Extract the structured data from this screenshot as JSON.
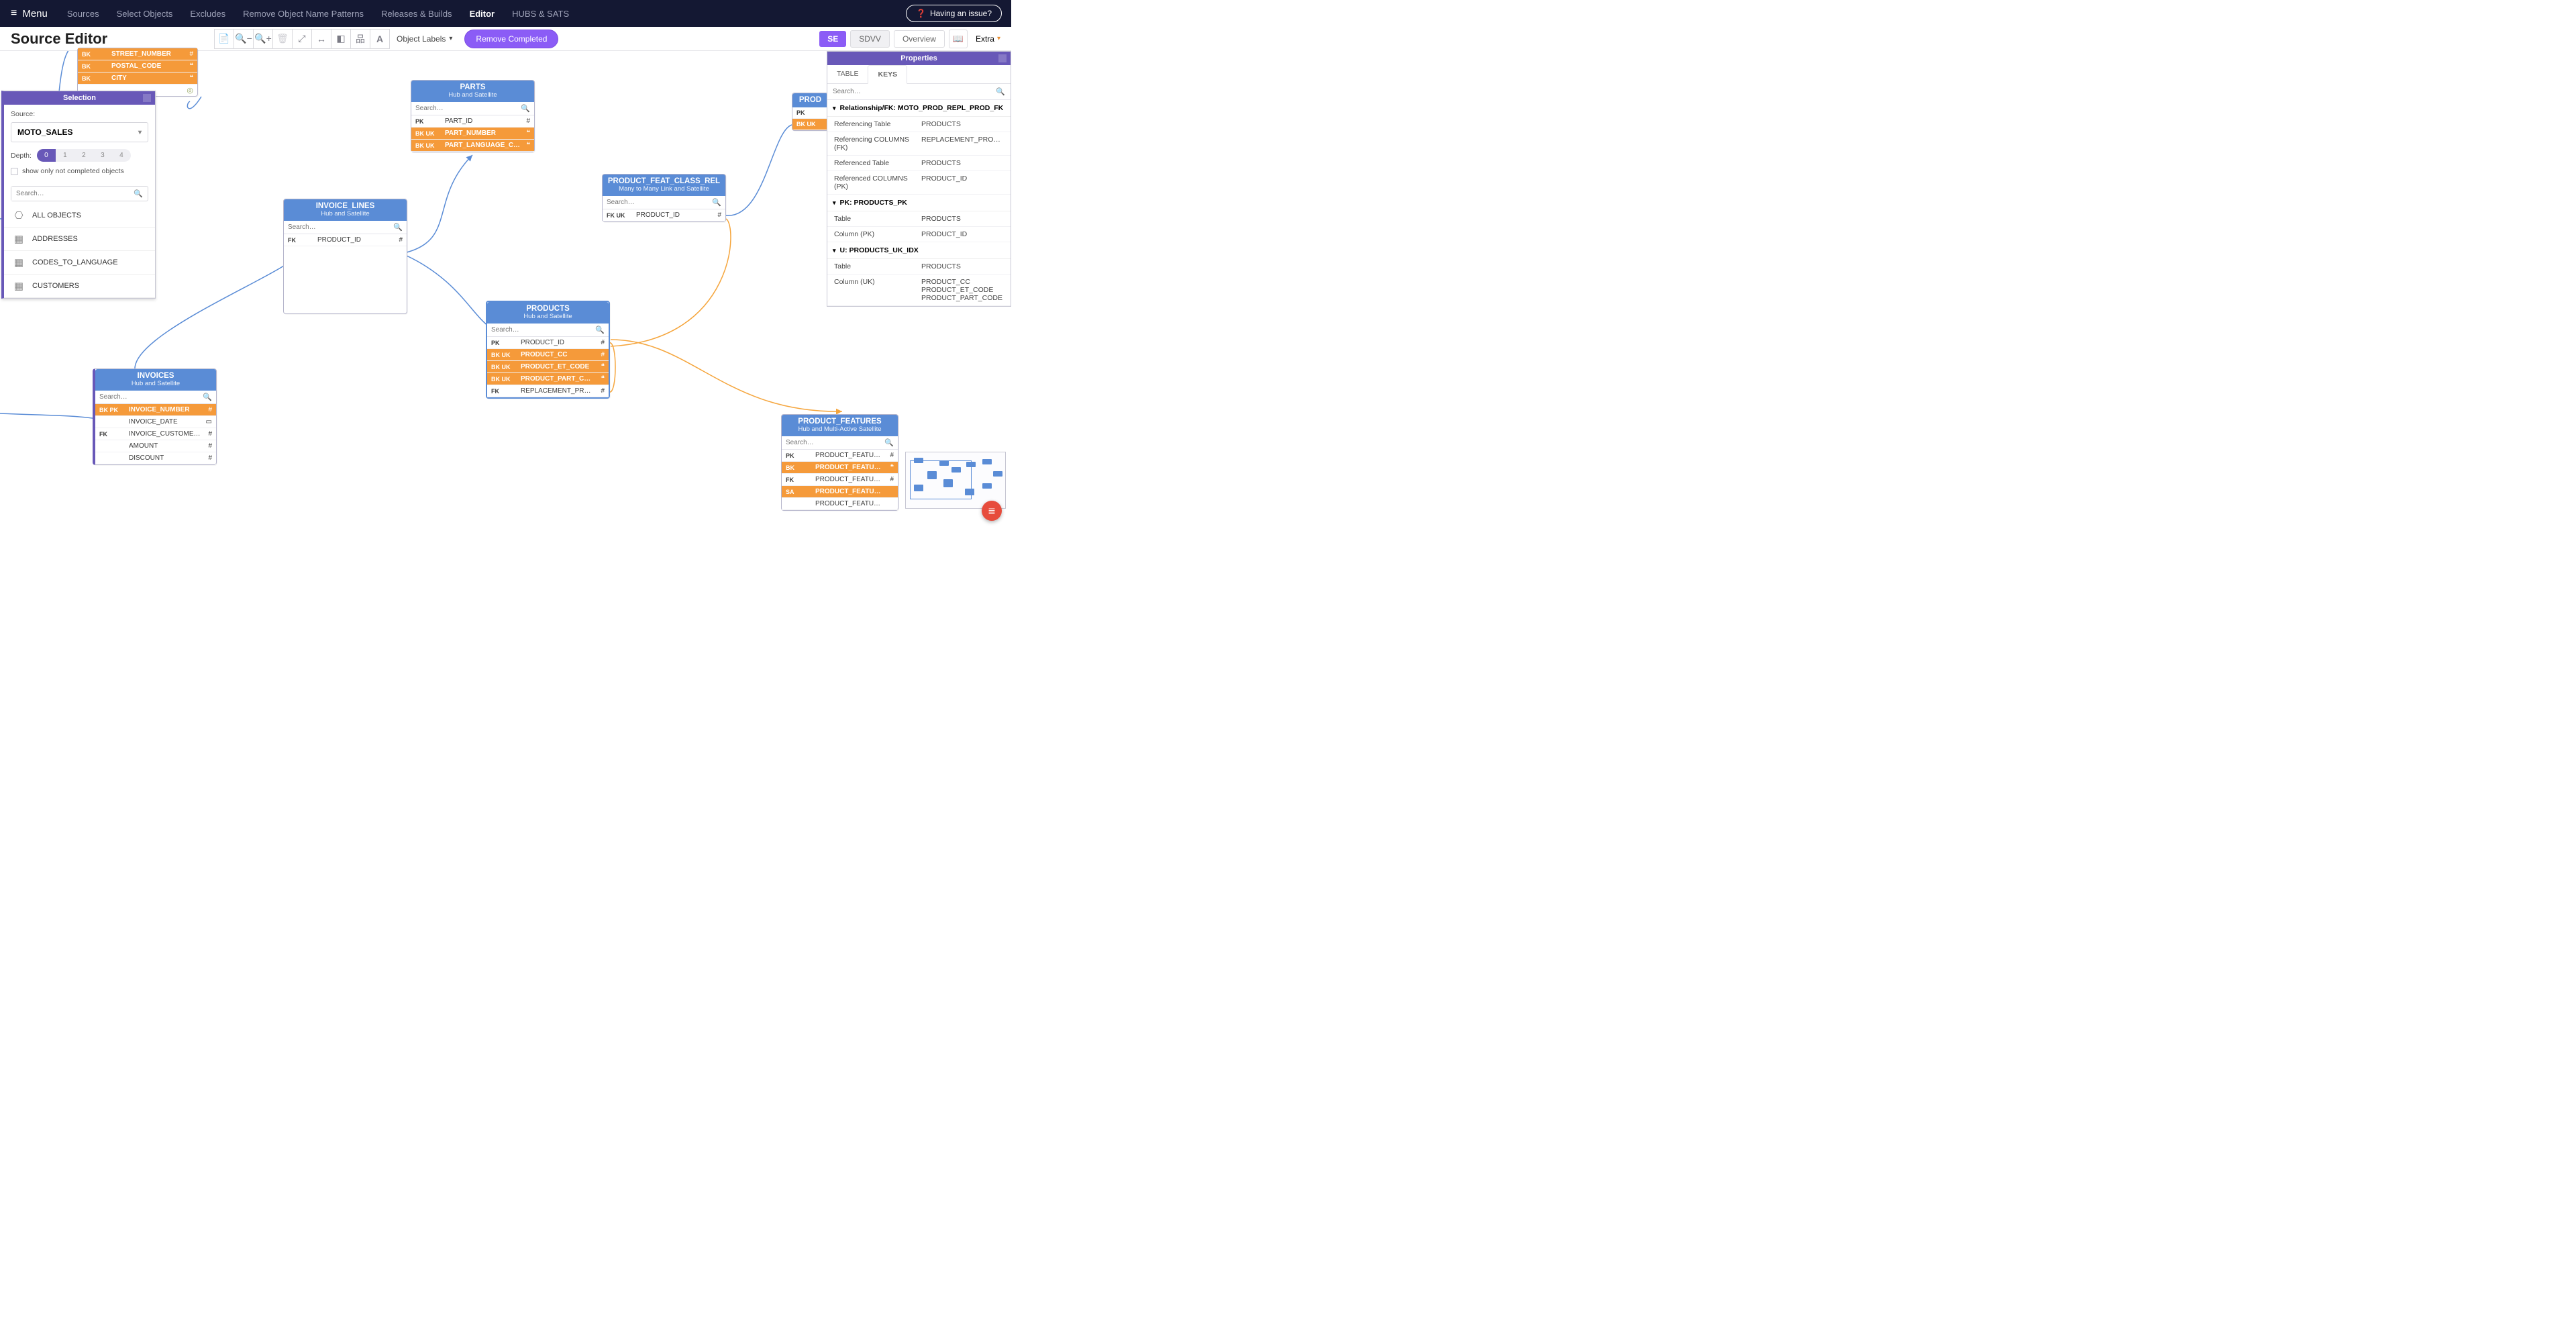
{
  "nav": {
    "menu": "Menu",
    "items": [
      "Sources",
      "Select Objects",
      "Excludes",
      "Remove Object Name Patterns",
      "Releases & Builds",
      "Editor",
      "HUBS & SATS"
    ],
    "active_index": 5,
    "issue": "Having an issue?"
  },
  "toolbar": {
    "title": "Source Editor",
    "object_labels": "Object Labels",
    "remove_completed": "Remove Completed",
    "pills": {
      "se": "SE",
      "sdvv": "SDVV",
      "overview": "Overview"
    },
    "extra": "Extra"
  },
  "selection_panel": {
    "title": "Selection",
    "source_label": "Source:",
    "source_value": "MOTO_SALES",
    "depth_label": "Depth:",
    "depth_values": [
      "0",
      "1",
      "2",
      "3",
      "4"
    ],
    "depth_active": 0,
    "checkbox_label": "show only not completed objects",
    "search_placeholder": "Search…",
    "items": [
      "ALL OBJECTS",
      "ADDRESSES",
      "CODES_TO_LANGUAGE",
      "CUSTOMERS"
    ]
  },
  "properties_panel": {
    "title": "Properties",
    "tabs": [
      "TABLE",
      "KEYS"
    ],
    "active_tab": 1,
    "search_placeholder": "Search…",
    "sections": [
      {
        "header": "Relationship/FK: MOTO_PROD_REPL_PROD_FK",
        "rows": [
          [
            "Referencing Table",
            "PRODUCTS"
          ],
          [
            "Referencing COLUMNS (FK)",
            "REPLACEMENT_PRODUC…"
          ],
          [
            "Referenced Table",
            "PRODUCTS"
          ],
          [
            "Referenced COLUMNS (PK)",
            "PRODUCT_ID"
          ]
        ]
      },
      {
        "header": "PK: PRODUCTS_PK",
        "rows": [
          [
            "Table",
            "PRODUCTS"
          ],
          [
            "Column (PK)",
            "PRODUCT_ID"
          ]
        ]
      },
      {
        "header": "U: PRODUCTS_UK_IDX",
        "rows": [
          [
            "Table",
            "PRODUCTS"
          ],
          [
            "Column (UK)",
            "PRODUCT_CC\nPRODUCT_ET_CODE\nPRODUCT_PART_CODE"
          ]
        ]
      }
    ]
  },
  "entities": {
    "addresses_frag": {
      "rows": [
        {
          "key": "BK",
          "col": "STREET_NUMBER",
          "typ": "#",
          "bk": true
        },
        {
          "key": "BK",
          "col": "POSTAL_CODE",
          "typ": "❝",
          "bk": true
        },
        {
          "key": "BK",
          "col": "CITY",
          "typ": "❝",
          "bk": true
        }
      ]
    },
    "parts": {
      "name": "PARTS",
      "sub": "Hub and Satellite",
      "search": "Search…",
      "rows": [
        {
          "key": "PK",
          "col": "PART_ID",
          "typ": "#"
        },
        {
          "key": "BK  UK",
          "col": "PART_NUMBER",
          "typ": "❝",
          "bk": true
        },
        {
          "key": "BK  UK",
          "col": "PART_LANGUAGE_CODE",
          "typ": "❝",
          "bk": true
        }
      ]
    },
    "invoice_lines": {
      "name": "INVOICE_LINES",
      "sub": "Hub and Satellite",
      "search": "Search…",
      "rows": [
        {
          "key": "FK",
          "col": "PRODUCT_ID",
          "typ": "#"
        }
      ]
    },
    "pfcrel": {
      "name": "PRODUCT_FEAT_CLASS_REL",
      "sub": "Many to Many Link and Satellite",
      "search": "Search…",
      "rows": [
        {
          "key": "FK UK",
          "col": "PRODUCT_ID",
          "typ": "#"
        }
      ]
    },
    "invoices": {
      "name": "INVOICES",
      "sub": "Hub and Satellite",
      "search": "Search…",
      "rows": [
        {
          "key": "BK  PK",
          "col": "INVOICE_NUMBER",
          "typ": "#",
          "bk": true
        },
        {
          "key": "",
          "col": "INVOICE_DATE",
          "typ": "▭"
        },
        {
          "key": "FK",
          "col": "INVOICE_CUSTOMER_ID",
          "typ": "#"
        },
        {
          "key": "",
          "col": "AMOUNT",
          "typ": "#"
        },
        {
          "key": "",
          "col": "DISCOUNT",
          "typ": "#"
        }
      ]
    },
    "products": {
      "name": "PRODUCTS",
      "sub": "Hub and Satellite",
      "search": "Search…",
      "selected": true,
      "rows": [
        {
          "key": "PK",
          "col": "PRODUCT_ID",
          "typ": "#"
        },
        {
          "key": "BK  UK",
          "col": "PRODUCT_CC",
          "typ": "#",
          "bk": true
        },
        {
          "key": "BK  UK",
          "col": "PRODUCT_ET_CODE",
          "typ": "❝",
          "bk": true
        },
        {
          "key": "BK  UK",
          "col": "PRODUCT_PART_CODE",
          "typ": "❝",
          "bk": true
        },
        {
          "key": "FK",
          "col": "REPLACEMENT_PRODUC…",
          "typ": "#"
        }
      ]
    },
    "product_features": {
      "name": "PRODUCT_FEATURES",
      "sub": "Hub and Multi-Active Satellite",
      "search": "Search…",
      "rows": [
        {
          "key": "PK",
          "col": "PRODUCT_FEATURE_ID",
          "typ": "#"
        },
        {
          "key": "BK",
          "col": "PRODUCT_FEATURE_CODE",
          "typ": "❝",
          "bk": true
        },
        {
          "key": "FK",
          "col": "PRODUCT_FEATURE_CAT_ID",
          "typ": "#"
        },
        {
          "key": "SA",
          "col": "PRODUCT_FEATURE_LANGUA",
          "typ": "",
          "bk": true
        },
        {
          "key": "",
          "col": "PRODUCT_FEATURE_DESCRIP",
          "typ": ""
        }
      ]
    },
    "prod_frag": {
      "name": "PROD",
      "rows": [
        {
          "key": "PK",
          "col": "",
          "typ": ""
        },
        {
          "key": "BK  UK",
          "col": "",
          "typ": "",
          "bk": true
        }
      ]
    }
  }
}
